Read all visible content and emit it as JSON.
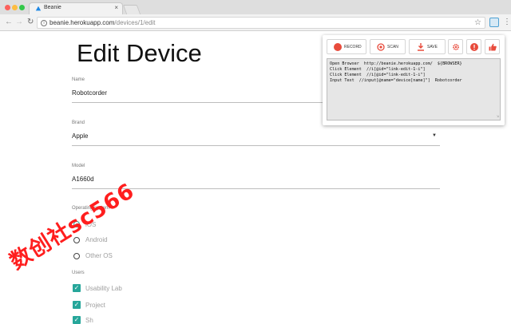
{
  "browser": {
    "tab_title": "Beanie",
    "tab_close": "×",
    "url_host": "beanie.herokuapp.com",
    "url_path": "/devices/1/edit"
  },
  "page": {
    "title": "Edit Device",
    "fields": {
      "name_label": "Name",
      "name_value": "Robotcorder",
      "brand_label": "Brand",
      "brand_value": "Apple",
      "model_label": "Model",
      "model_value": "A1660d",
      "os_label": "Operating system",
      "os_options": [
        "iOS",
        "Android",
        "Other OS"
      ],
      "os_selected": "iOS",
      "users_label": "Users",
      "users": [
        "Usability Lab",
        "Project",
        "Sh"
      ]
    }
  },
  "popup": {
    "record_label": "RECORD",
    "scan_label": "SCAN",
    "save_label": "SAVE",
    "script_lines": [
      "Open Browser  http://beanie.herokuapp.com/  ${BROWSER}",
      "Click Element  //i[@id=\"link-edit-1-i\"]",
      "Click Element  //i[@id=\"link-edit-1-i\"]",
      "Input Text  //input[@name=\"device[name]\"]  Robotcorder"
    ],
    "accent": "#e84b3c"
  },
  "watermark": "数创社sc566",
  "colors": {
    "teal": "#26a69a",
    "red": "#e84b3c"
  }
}
